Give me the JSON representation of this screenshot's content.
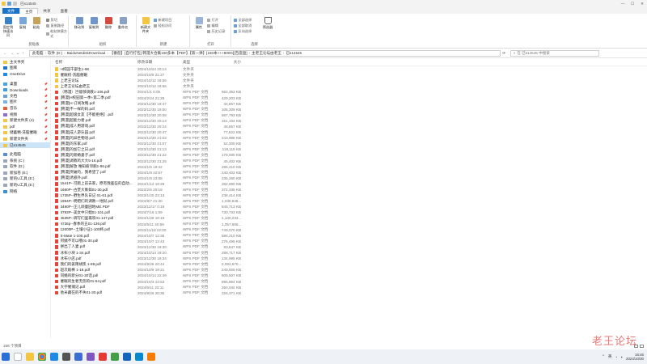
{
  "window": {
    "title": "已s14545",
    "controls": [
      "—",
      "☐",
      "✕"
    ]
  },
  "ribbon_tabs": [
    "文件",
    "主页",
    "共享",
    "查看"
  ],
  "ribbon": {
    "clipboard": {
      "label": "剪贴板",
      "pin": "固定到快速访问",
      "copy": "复制",
      "paste": "粘贴",
      "cut": "剪切",
      "copy_path": "复制路径",
      "paste_shortcut": "粘贴快捷方式"
    },
    "organize": {
      "label": "组织",
      "move_to": "移动到",
      "copy_to": "复制到",
      "delete": "删除",
      "rename": "重命名"
    },
    "new": {
      "label": "新建",
      "new_folder": "新建文件夹",
      "new_item": "新建项目",
      "easy_access": "轻松访问"
    },
    "open": {
      "label": "打开",
      "properties": "属性",
      "open": "打开",
      "edit": "编辑",
      "history": "历史记录"
    },
    "select": {
      "label": "选择",
      "select_all": "全部选择",
      "select_none": "全部取消",
      "invert": "反向选择",
      "filter": "筛选器"
    }
  },
  "address": {
    "crumbs": [
      "此电脑",
      "软件 (D:)",
      "BaiduNetdiskDownload",
      "【番茄】[自行打包] 韩漫大合集150多本【PDF】【第一弹】[150本+++800G][百度盘]",
      "主老王论坛由老王",
      "已s14545"
    ],
    "search_placeholder": "在 已s14545 中搜索"
  },
  "nav": [
    {
      "label": "主文件夹",
      "pin": false
    },
    {
      "label": "图库",
      "pin": false
    },
    {
      "label": "OneDrive",
      "pin": false
    },
    {
      "label": "",
      "gap": true
    },
    {
      "label": "桌面",
      "pin": true
    },
    {
      "label": "Downloads",
      "pin": true
    },
    {
      "label": "文档",
      "pin": true
    },
    {
      "label": "图片",
      "pin": true
    },
    {
      "label": "音乐",
      "pin": true
    },
    {
      "label": "视频",
      "pin": true
    },
    {
      "label": "新建文件夹 (4)",
      "pin": true
    },
    {
      "label": "pdf",
      "pin": true
    },
    {
      "label": "储蓄精-洗脑催眠",
      "pin": true
    },
    {
      "label": "新建文件夹",
      "pin": true
    },
    {
      "label": "已s14545",
      "pin": false,
      "selected": true
    },
    {
      "label": "",
      "gap": true
    },
    {
      "label": "此电脑",
      "pin": false
    },
    {
      "label": "系统 (C:)",
      "pin": false
    },
    {
      "label": "软件 (D:)",
      "pin": false
    },
    {
      "label": "新加卷 (E:)",
      "pin": false
    },
    {
      "label": "新的U工具 (E:)",
      "pin": false
    },
    {
      "label": "新的U工具 (E:)",
      "pin": false
    },
    {
      "label": "网络",
      "pin": false
    }
  ],
  "columns": {
    "name": "名称",
    "date": "修改日期",
    "type": "类型",
    "size": "大小"
  },
  "files": [
    {
      "name": "H校园干部生1-98",
      "date": "2024/10/24 20:13",
      "type": "文件夹",
      "size": "",
      "kind": "folder"
    },
    {
      "name": "催眠校-洗脑催眠",
      "date": "2024/10/8 21:27",
      "type": "文件夹",
      "size": "",
      "kind": "folder"
    },
    {
      "name": "上老王论坛",
      "date": "2024/10/12 18:56",
      "type": "文件夹",
      "size": "",
      "kind": "folder"
    },
    {
      "name": "上老王论坛由老王",
      "date": "2024/10/12 18:56",
      "type": "文件夹",
      "size": "",
      "kind": "folder"
    },
    {
      "name": "（韩漫）岂能够调教1-106.pdf",
      "date": "2024/1/1 0:05",
      "type": "WPS PDF 文档",
      "size": "662,353 KB",
      "kind": "pdf"
    },
    {
      "name": "[韩漫]H校园第一季+第二季.pdf",
      "date": "2024/2/24 21:28",
      "type": "WPS PDF 文档",
      "size": "429,203 KB",
      "kind": "pdf"
    },
    {
      "name": "[韩漫]H-订阅攻略.pdf",
      "date": "2023/12/30 19:47",
      "type": "WPS PDF 文档",
      "size": "34,857 KB",
      "kind": "pdf"
    },
    {
      "name": "[韩漫]不一样的妈.pdf",
      "date": "2023/12/30 19:50",
      "type": "WPS PDF 文档",
      "size": "105,309 KB",
      "kind": "pdf"
    },
    {
      "name": "[韩漫]超级女友【不能拒绝】.pdf",
      "date": "2023/12/30 20:08",
      "type": "WPS PDF 文档",
      "size": "587,793 KB",
      "kind": "pdf"
    },
    {
      "name": "[韩漫]超能力者.pdf",
      "date": "2023/12/30 20:14",
      "type": "WPS PDF 文档",
      "size": "151,164 KB",
      "kind": "pdf"
    },
    {
      "name": "[韩漫]成人用游戏.pdf",
      "date": "2023/12/30 20:24",
      "type": "WPS PDF 文档",
      "size": "48,857 KB",
      "kind": "pdf"
    },
    {
      "name": "[韩漫]成人游乐园.pdf",
      "date": "2023/12/30 20:47",
      "type": "WPS PDF 文档",
      "size": "77,822 KB",
      "kind": "pdf"
    },
    {
      "name": "[韩漫]的异世物语.pdf",
      "date": "2023/12/30 21:03",
      "type": "WPS PDF 文档",
      "size": "243,988 KB",
      "kind": "pdf"
    },
    {
      "name": "[韩漫]的东家.pdf",
      "date": "2023/12/30 21:07",
      "type": "WPS PDF 文档",
      "size": "52,300 KB",
      "kind": "pdf"
    },
    {
      "name": "[韩漫]的加它之日.pdf",
      "date": "2023/12/30 21:13",
      "type": "WPS PDF 文档",
      "size": "118,119 KB",
      "kind": "pdf"
    },
    {
      "name": "[韩漫]的新婚妻子.pdf",
      "date": "2023/12/30 21:22",
      "type": "WPS PDF 文档",
      "size": "178,000 KB",
      "kind": "pdf"
    },
    {
      "name": "[韩漫]调教鸡大大5-16.pdf",
      "date": "2023/12/30 21:25",
      "type": "WPS PDF 文档",
      "size": "45,402 KB",
      "kind": "pdf"
    },
    {
      "name": "[韩漫]解放 唯知彼邻鹅1-86.pdf",
      "date": "2024/1/6 19:42",
      "type": "WPS PDF 文档",
      "size": "285,410 KB",
      "kind": "pdf"
    },
    {
      "name": "[韩漫]突破的，我希望了.pdf",
      "date": "2024/1/9 22:57",
      "type": "WPS PDF 文档",
      "size": "240,402 KB",
      "kind": "pdf"
    },
    {
      "name": "[韩漫]诱惑外.pdf",
      "date": "2024/1/9 23:08",
      "type": "WPS PDF 文档",
      "size": "235,260 KB",
      "kind": "pdf"
    },
    {
      "name": "1541P--可跑上前去家，原有我差些的自动...",
      "date": "2024/1/12 19:29",
      "type": "WPS PDF 文档",
      "size": "282,880 KB",
      "kind": "pdf"
    },
    {
      "name": "1660P--古堡大象如01-30.pdf",
      "date": "2023/2/6 20:18",
      "type": "WPS PDF 文档",
      "size": "372,335 KB",
      "kind": "pdf"
    },
    {
      "name": "1735P--野生界队日记 01-61.pdf",
      "date": "2023/1/20 23:13",
      "type": "WPS PDF 文档",
      "size": "238,414 KB",
      "kind": "pdf"
    },
    {
      "name": "1954P--明把们的调教一地狱.pdf",
      "date": "2024/9/7 21:30",
      "type": "WPS PDF 文档",
      "size": "1,038,948...",
      "kind": "pdf"
    },
    {
      "name": "3490P--正儿顽童园地ME.PDF",
      "date": "2023/12/17 0:19",
      "type": "WPS PDF 文档",
      "size": "845,713 KB",
      "kind": "pdf"
    },
    {
      "name": "3793P--美女中只娼01-101.pdf",
      "date": "2024/7/16 1:59",
      "type": "WPS PDF 文档",
      "size": "730,733 KB",
      "kind": "pdf"
    },
    {
      "name": "4535P--调写们里再欢01-147.pdf",
      "date": "2024/1/28 19:19",
      "type": "WPS PDF 文档",
      "size": "1,130,233...",
      "kind": "pdf"
    },
    {
      "name": "4736p--春季的五01-136.pdf",
      "date": "2023/5/11 20:59",
      "type": "WPS PDF 文档",
      "size": "1,057,665...",
      "kind": "pdf"
    },
    {
      "name": "12000P--土壤小征1-100终.pdf",
      "date": "2023/11/18 22:00",
      "type": "WPS PDF 文档",
      "size": "749,070 KB",
      "kind": "pdf"
    },
    {
      "name": "S-Mate 1-100.pdf",
      "date": "2024/10/7 12:36",
      "type": "WPS PDF 文档",
      "size": "586,210 KB",
      "kind": "pdf"
    },
    {
      "name": "阿姨不可以哦01-30.pdf",
      "date": "2024/10/7 12:43",
      "type": "WPS PDF 文档",
      "size": "276,495 KB",
      "kind": "pdf"
    },
    {
      "name": "拼出了人妻.pdf",
      "date": "2023/12/30 19:30",
      "type": "WPS PDF 文档",
      "size": "93,847 KB",
      "kind": "pdf"
    },
    {
      "name": "冰布小块 1-34.pdf",
      "date": "2024/10/14 19:20",
      "type": "WPS PDF 文档",
      "size": "288,717 KB",
      "kind": "pdf"
    },
    {
      "name": "冰布小店.pdf",
      "date": "2023/12/30 19:34",
      "type": "WPS PDF 文档",
      "size": "134,995 KB",
      "kind": "pdf"
    },
    {
      "name": "我们的姜雨胡凯 1-89.pdf",
      "date": "2024/9/26 20:44",
      "type": "WPS PDF 文档",
      "size": "2,093,670...",
      "kind": "pdf"
    },
    {
      "name": "超次殿棒 1-18.pdf",
      "date": "2024/10/6 19:21",
      "type": "WPS PDF 文档",
      "size": "249,929 KB",
      "kind": "pdf"
    },
    {
      "name": "同婚的新分01-30话.pdf",
      "date": "2024/10/14 22:49",
      "type": "WPS PDF 文档",
      "size": "609,507 KB",
      "kind": "pdf"
    },
    {
      "name": "催眠的生者无怨的01-54.pdf",
      "date": "2024/10/3 14:53",
      "type": "WPS PDF 文档",
      "size": "855,864 KB",
      "kind": "pdf"
    },
    {
      "name": "大学催捕记.pdf",
      "date": "2024/6/11 23:11",
      "type": "WPS PDF 文档",
      "size": "260,044 KB",
      "kind": "pdf"
    },
    {
      "name": "他米藏在的不失01-30.pdf",
      "date": "2024/9/26 20:36",
      "type": "WPS PDF 文档",
      "size": "326,371 KB",
      "kind": "pdf"
    }
  ],
  "status": {
    "count": "158 个项目"
  },
  "taskbar": {
    "time": "16:46",
    "date": "2024/10/30",
    "lang": "英"
  },
  "watermark": "老王论坛",
  "colors": {
    "accent": "#1a73c8",
    "folder": "#f4c542",
    "pdf": "#e2453c",
    "selected": "#cce4f7"
  }
}
